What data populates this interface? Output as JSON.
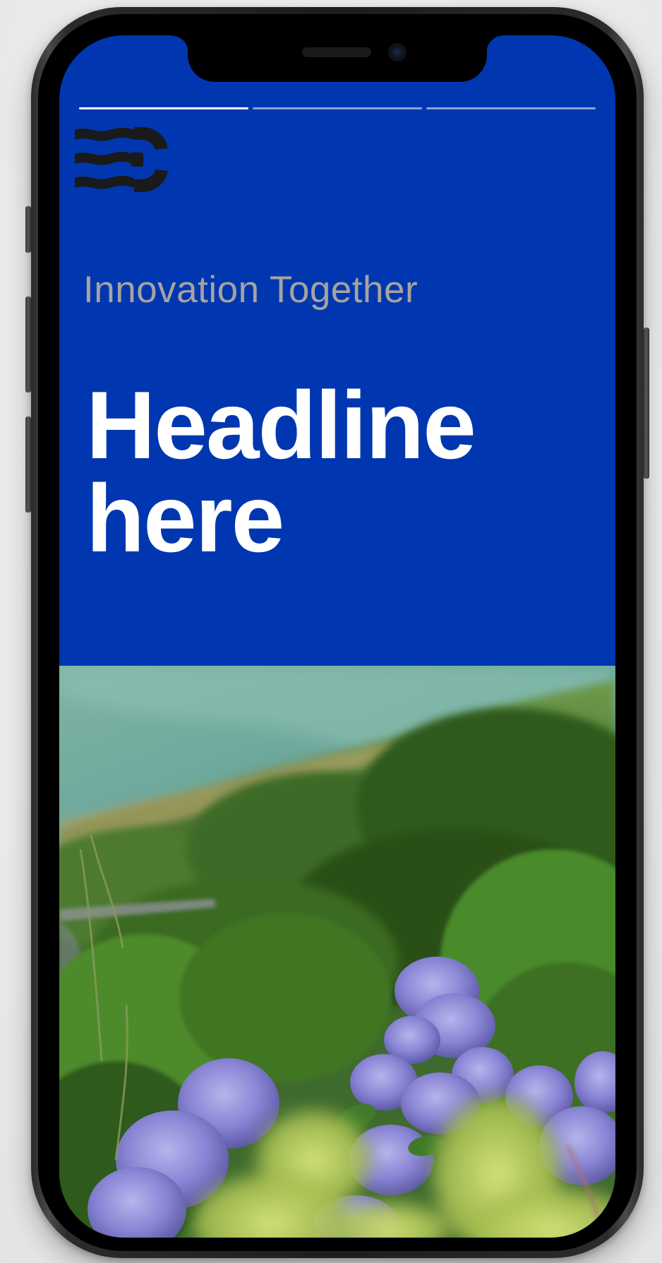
{
  "screen": {
    "tagline": "Innovation Together",
    "headline_lines": [
      "Headline",
      "here"
    ],
    "story_progress": {
      "segments": 3,
      "active_index": 0
    },
    "logo": "ec-wave-logo",
    "hero_photo": "hydrangea-hillside-photo"
  },
  "colors": {
    "hero_background": "#0037b0",
    "tagline": "#a7a3a0",
    "headline": "#ffffff",
    "logo": "#1a1a1a"
  }
}
